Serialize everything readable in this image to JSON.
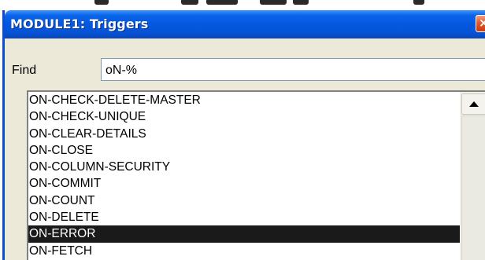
{
  "window": {
    "title": "MODULE1: Triggers",
    "close_glyph": "×"
  },
  "find": {
    "label": "Find",
    "value": "oN-%"
  },
  "list": {
    "items": [
      "ON-CHECK-DELETE-MASTER",
      "ON-CHECK-UNIQUE",
      "ON-CLEAR-DETAILS",
      "ON-CLOSE",
      "ON-COLUMN-SECURITY",
      "ON-COMMIT",
      "ON-COUNT",
      "ON-DELETE",
      "ON-ERROR",
      "ON-FETCH"
    ],
    "selected_index": 8
  },
  "colors": {
    "titlebar": "#0553d6",
    "selection": "#1a1a1a",
    "dialog_bg": "#ece9d8"
  },
  "icons": {
    "close": "close-icon",
    "scroll_up": "arrow-up-icon"
  }
}
